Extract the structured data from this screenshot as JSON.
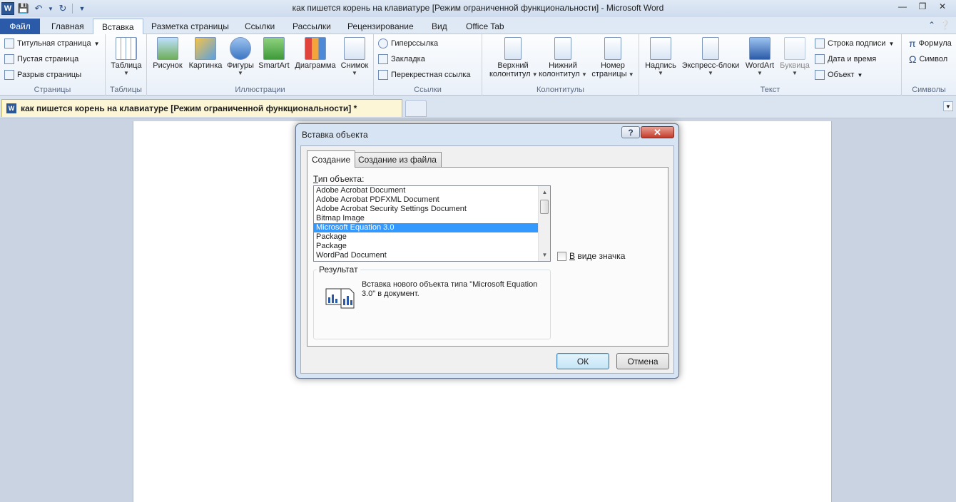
{
  "window": {
    "title": "как пишется корень на клавиатуре [Режим ограниченной функциональности]  -  Microsoft Word"
  },
  "qat": {
    "logo": "W"
  },
  "ribbon_tabs": [
    "Файл",
    "Главная",
    "Вставка",
    "Разметка страницы",
    "Ссылки",
    "Рассылки",
    "Рецензирование",
    "Вид",
    "Office Tab"
  ],
  "ribbon": {
    "pages": {
      "label": "Страницы",
      "items": [
        "Титульная страница",
        "Пустая страница",
        "Разрыв страницы"
      ]
    },
    "tables": {
      "label": "Таблицы",
      "table": "Таблица"
    },
    "illustrations": {
      "label": "Иллюстрации",
      "items": [
        "Рисунок",
        "Картинка",
        "Фигуры",
        "SmartArt",
        "Диаграмма",
        "Снимок"
      ]
    },
    "links": {
      "label": "Ссылки",
      "items": [
        "Гиперссылка",
        "Закладка",
        "Перекрестная ссылка"
      ]
    },
    "headers": {
      "label": "Колонтитулы",
      "header_1": "Верхний",
      "header_2": "колонтитул",
      "footer_1": "Нижний",
      "footer_2": "колонтитул",
      "pagenum_1": "Номер",
      "pagenum_2": "страницы"
    },
    "text": {
      "label": "Текст",
      "textbox": "Надпись",
      "quickparts": "Экспресс-блоки",
      "wordart": "WordArt",
      "dropcap": "Буквица",
      "signature": "Строка подписи",
      "datetime": "Дата и время",
      "object": "Объект"
    },
    "symbols": {
      "label": "Символы",
      "formula": "Формула",
      "symbol": "Символ"
    }
  },
  "doc_tab": {
    "title": "как пишется корень на клавиатуре [Режим ограниченной функциональности] *",
    "icon": "W"
  },
  "dialog": {
    "title": "Вставка объекта",
    "help": "?",
    "close": "✕",
    "tabs": [
      "Создание",
      "Создание из файла"
    ],
    "type_label_u": "Т",
    "type_label_rest": "ип объекта:",
    "object_types": [
      "Adobe Acrobat Document",
      "Adobe Acrobat PDFXML Document",
      "Adobe Acrobat Security Settings Document",
      "Bitmap Image",
      "Microsoft Equation 3.0",
      "Package",
      "Package",
      "WordPad Document"
    ],
    "selected_index": 4,
    "display_as_icon_u": "В",
    "display_as_icon_rest": " виде значка",
    "result_label": "Результат",
    "result_text": "Вставка нового объекта типа \"Microsoft Equation 3.0\" в документ.",
    "ok": "ОК",
    "cancel": "Отмена"
  }
}
